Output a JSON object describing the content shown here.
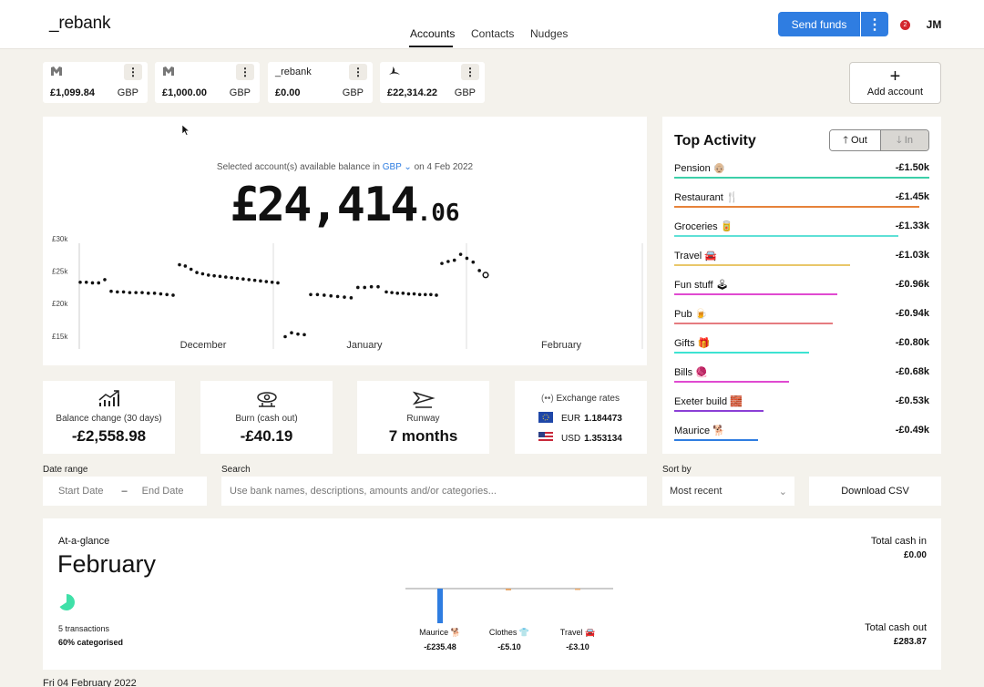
{
  "header": {
    "logo": "_rebank",
    "nav": [
      "Accounts",
      "Contacts",
      "Nudges"
    ],
    "send_funds": "Send funds",
    "more_icon": "⋮",
    "notif_count": "2",
    "avatar": "JM"
  },
  "accounts": [
    {
      "icon": "monzo-icon",
      "name": "",
      "amount": "£1,099.84",
      "currency": "GBP"
    },
    {
      "icon": "monzo-icon",
      "name": "",
      "amount": "£1,000.00",
      "currency": "GBP"
    },
    {
      "icon": "",
      "name": "_rebank",
      "amount": "£0.00",
      "currency": "GBP"
    },
    {
      "icon": "santander-icon",
      "name": "",
      "amount": "£22,314.22",
      "currency": "GBP"
    }
  ],
  "add_account": "Add account",
  "balance": {
    "caption_pre": "Selected account(s) available balance in",
    "currency": "GBP",
    "caption_post": "on 4 Feb 2022",
    "main": "£24,414",
    "decimals": ".06"
  },
  "chart_data": {
    "type": "scatter",
    "y_ticks": [
      "£30k",
      "£25k",
      "£20k",
      "£15k"
    ],
    "ylim": [
      13000,
      31000
    ],
    "months": [
      "December",
      "January",
      "February"
    ],
    "points": [
      [
        0,
        23300
      ],
      [
        1,
        23300
      ],
      [
        2,
        23200
      ],
      [
        3,
        23200
      ],
      [
        4,
        23700
      ],
      [
        5,
        21900
      ],
      [
        6,
        21800
      ],
      [
        7,
        21800
      ],
      [
        8,
        21700
      ],
      [
        9,
        21700
      ],
      [
        10,
        21700
      ],
      [
        11,
        21600
      ],
      [
        12,
        21600
      ],
      [
        13,
        21500
      ],
      [
        14,
        21400
      ],
      [
        15,
        21300
      ],
      [
        16,
        26000
      ],
      [
        17,
        25800
      ],
      [
        18,
        25300
      ],
      [
        19,
        24800
      ],
      [
        20,
        24600
      ],
      [
        21,
        24400
      ],
      [
        22,
        24300
      ],
      [
        23,
        24200
      ],
      [
        24,
        24100
      ],
      [
        25,
        24000
      ],
      [
        26,
        23900
      ],
      [
        27,
        23800
      ],
      [
        28,
        23700
      ],
      [
        29,
        23600
      ],
      [
        30,
        23500
      ],
      [
        31,
        23400
      ],
      [
        32,
        23300
      ],
      [
        33,
        23200
      ],
      [
        34,
        14900
      ],
      [
        35,
        15500
      ],
      [
        36,
        15300
      ],
      [
        37,
        15200
      ],
      [
        38,
        21400
      ],
      [
        39,
        21400
      ],
      [
        40,
        21300
      ],
      [
        41,
        21200
      ],
      [
        42,
        21100
      ],
      [
        43,
        21000
      ],
      [
        44,
        20900
      ],
      [
        45,
        22500
      ],
      [
        46,
        22500
      ],
      [
        47,
        22600
      ],
      [
        48,
        22600
      ],
      [
        49,
        21800
      ],
      [
        50,
        21700
      ],
      [
        51,
        21600
      ],
      [
        52,
        21600
      ],
      [
        53,
        21500
      ],
      [
        54,
        21500
      ],
      [
        55,
        21400
      ],
      [
        56,
        21400
      ],
      [
        57,
        21400
      ],
      [
        58,
        21300
      ],
      [
        59,
        26200
      ],
      [
        60,
        26500
      ],
      [
        61,
        26700
      ],
      [
        62,
        27600
      ],
      [
        63,
        27000
      ],
      [
        64,
        26400
      ],
      [
        65,
        25100
      ],
      [
        66,
        24414
      ]
    ]
  },
  "activity": {
    "title": "Top Activity",
    "out_label": "Out",
    "in_label": "In",
    "rows": [
      {
        "label": "Pension 👴🏼",
        "value": "-£1.50k",
        "color": "#3ccfa8",
        "fraction": 1.0
      },
      {
        "label": "Restaurant 🍴",
        "value": "-£1.45k",
        "color": "#e6823a",
        "fraction": 0.96
      },
      {
        "label": "Groceries 🥫",
        "value": "-£1.33k",
        "color": "#5fe0d6",
        "fraction": 0.88
      },
      {
        "label": "Travel 🚘",
        "value": "-£1.03k",
        "color": "#e9c76a",
        "fraction": 0.69
      },
      {
        "label": "Fun stuff 🕹",
        "value": "-£0.96k",
        "color": "#e04ad1",
        "fraction": 0.64
      },
      {
        "label": "Pub 🍺",
        "value": "-£0.94k",
        "color": "#e57b80",
        "fraction": 0.62
      },
      {
        "label": "Gifts 🎁",
        "value": "-£0.80k",
        "color": "#3de3d2",
        "fraction": 0.53
      },
      {
        "label": "Bills 🧶",
        "value": "-£0.68k",
        "color": "#e04ad1",
        "fraction": 0.45
      },
      {
        "label": "Exeter build 🧱",
        "value": "-£0.53k",
        "color": "#8b3fd6",
        "fraction": 0.35
      },
      {
        "label": "Maurice 🐕",
        "value": "-£0.49k",
        "color": "#2f7de1",
        "fraction": 0.33
      }
    ]
  },
  "stats": [
    {
      "icon": "trend-up-icon",
      "label": "Balance change (30 days)",
      "value": "-£2,558.98"
    },
    {
      "icon": "eye-icon",
      "label": "Burn (cash out)",
      "value": "-£40.19"
    },
    {
      "icon": "paper-plane-icon",
      "label": "Runway",
      "value": "7 months"
    }
  ],
  "exchange": {
    "title": "Exchange rates",
    "rows": [
      {
        "flag": "eu-flag-icon",
        "code": "EUR",
        "rate": "1.184473"
      },
      {
        "flag": "us-flag-icon",
        "code": "USD",
        "rate": "1.353134"
      }
    ]
  },
  "filters": {
    "date_range_label": "Date range",
    "start_placeholder": "Start Date",
    "dash": "–",
    "end_placeholder": "End Date",
    "search_label": "Search",
    "search_placeholder": "Use bank names, descriptions, amounts and/or categories...",
    "sort_label": "Sort by",
    "sort_value": "Most recent",
    "download": "Download CSV"
  },
  "glance": {
    "label": "At-a-glance",
    "month": "February",
    "transactions": "5 transactions",
    "categorised": "60% categorised",
    "total_in_label": "Total cash in",
    "total_in": "£0.00",
    "total_out_label": "Total cash out",
    "total_out": "£283.87",
    "categories": [
      {
        "label": "Maurice 🐕",
        "value": "-£235.48"
      },
      {
        "label": "Clothes 👕",
        "value": "-£5.10"
      },
      {
        "label": "Travel 🚘",
        "value": "-£3.10"
      }
    ]
  },
  "footer_date": "Fri 04 February 2022"
}
